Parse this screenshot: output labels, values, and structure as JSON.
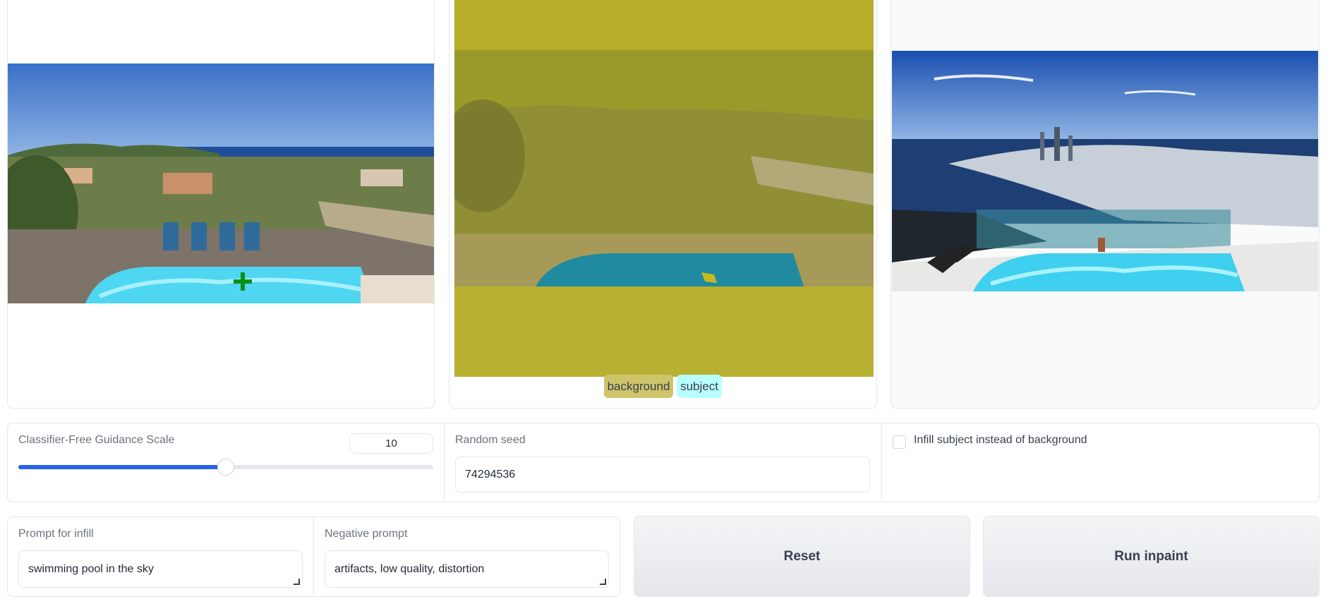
{
  "panels": {
    "mask_legend": {
      "background": "background",
      "subject": "subject"
    }
  },
  "controls": {
    "guidance": {
      "label": "Classifier-Free Guidance Scale",
      "value": "10",
      "slider_fraction": 0.5
    },
    "seed": {
      "label": "Random seed",
      "value": "74294536"
    },
    "infill_subject": {
      "label": "Infill subject instead of background",
      "checked": false
    }
  },
  "prompts": {
    "infill": {
      "label": "Prompt for infill",
      "value": "swimming pool in the sky"
    },
    "negative": {
      "label": "Negative prompt",
      "value": "artifacts, low quality, distortion"
    }
  },
  "buttons": {
    "reset": "Reset",
    "run": "Run inpaint"
  },
  "colors": {
    "accent": "#2563eb",
    "mask_background": "#b8b030",
    "mask_subject": "#a8ffff",
    "legend_background_chip": "#cfc46a",
    "legend_subject_chip": "#b9feff"
  }
}
